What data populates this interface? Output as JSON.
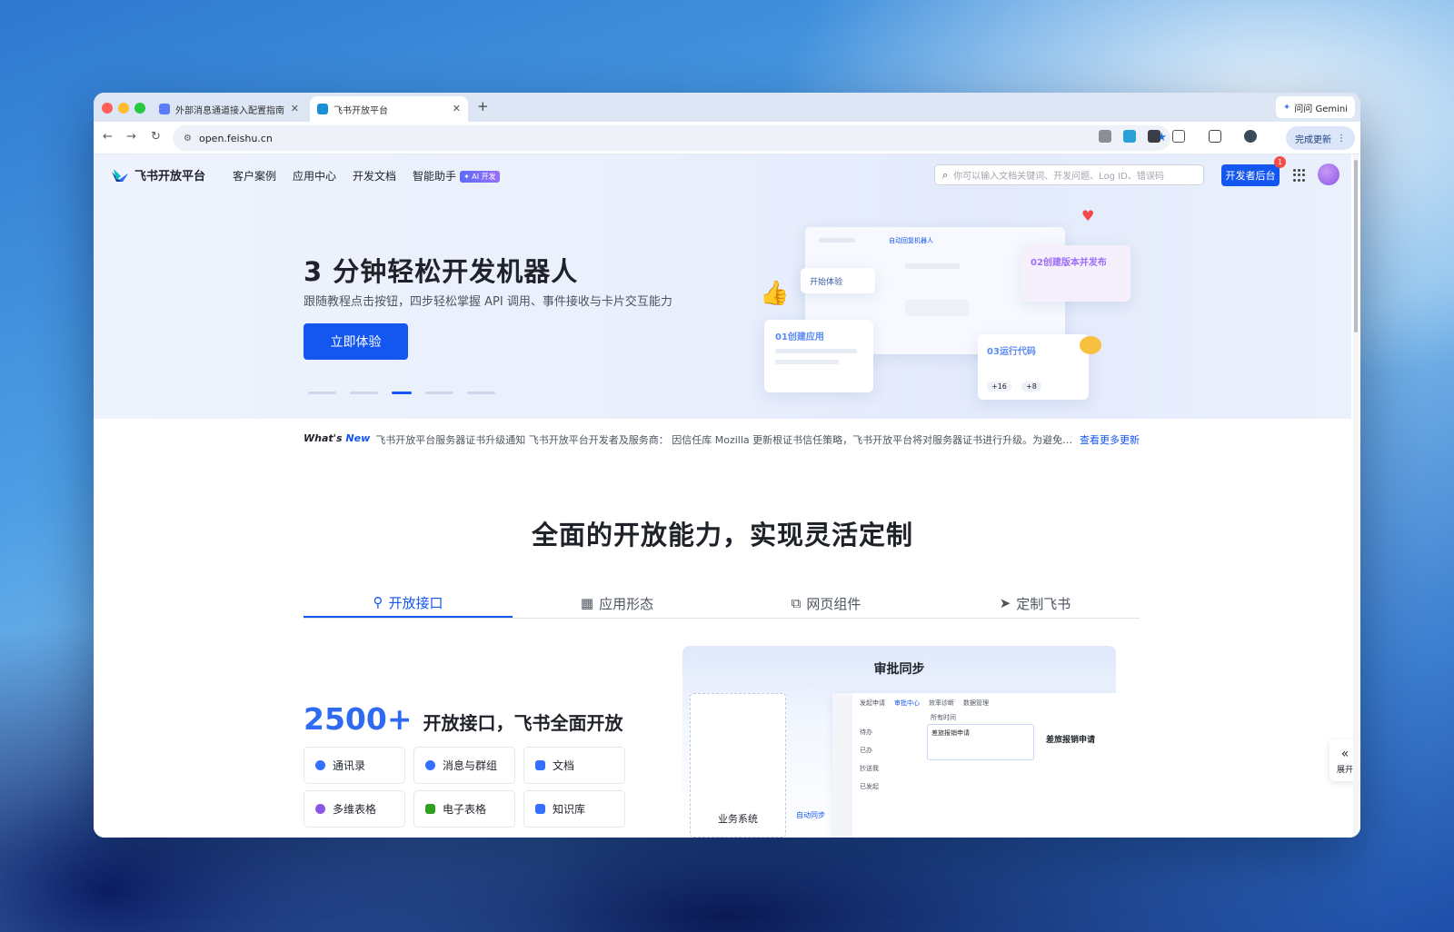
{
  "browser": {
    "tabs": [
      {
        "title": "外部消息通道接入配置指南"
      },
      {
        "title": "飞书开放平台"
      }
    ],
    "new_tab": "+",
    "gemini": "问问 Gemini",
    "url": "open.feishu.cn",
    "update": "完成更新"
  },
  "header": {
    "logo": "飞书开放平台",
    "nav": [
      "客户案例",
      "应用中心",
      "开发文档",
      "智能助手"
    ],
    "ai_badge": "✦ AI 开发",
    "search_placeholder": "你可以输入文档关键词、开发问题、Log ID、错误码",
    "dev_console": "开发者后台",
    "notification_count": "1"
  },
  "hero": {
    "title": "3 分钟轻松开发机器人",
    "subtitle": "跟随教程点击按钮，四步轻松掌握 API 调用、事件接收与卡片交互能力",
    "cta": "立即体验",
    "carousel_active_index": 2,
    "illustration": {
      "bot_name": "自动回复机器人",
      "start": "开始体验",
      "step1": "01创建应用",
      "step2": "02创建版本并发布",
      "step3": "03运行代码",
      "reaction1": "+16",
      "reaction2": "+8"
    }
  },
  "whats_new": {
    "label_prefix": "What's",
    "label_suffix": "New",
    "text": "飞书开放平台服务器证书升级通知 飞书开放平台开发者及服务商： 因信任库 Mozilla 更新根证书信任策略，飞书开放平台将对服务器证书进行升级。为避免您的...",
    "more": "查看更多更新"
  },
  "capabilities": {
    "title": "全面的开放能力，实现灵活定制",
    "tabs": [
      "开放接口",
      "应用形态",
      "网页组件",
      "定制飞书"
    ],
    "active_tab": 0,
    "stat_number": "2500+",
    "stat_text": "开放接口，飞书全面开放",
    "chips": [
      "通讯录",
      "消息与群组",
      "文档",
      "多维表格",
      "电子表格",
      "知识库"
    ],
    "preview": {
      "title": "审批同步",
      "business_system": "业务系统",
      "auto_sync": "自动同步",
      "mock_tabs": [
        "发起申请",
        "审批中心",
        "效率诊断",
        "数据管理"
      ],
      "mock_list": [
        "待办",
        "已办",
        "抄送我",
        "已发起"
      ],
      "mock_filter": "所有时间",
      "mock_item": "差旅报销申请",
      "mock_detail_title": "差旅报销申请"
    },
    "expand_label": "展开"
  },
  "colors": {
    "brand_blue": "#1456f0",
    "stat_blue": "#2f6bf2",
    "badge_red": "#f54a45"
  }
}
